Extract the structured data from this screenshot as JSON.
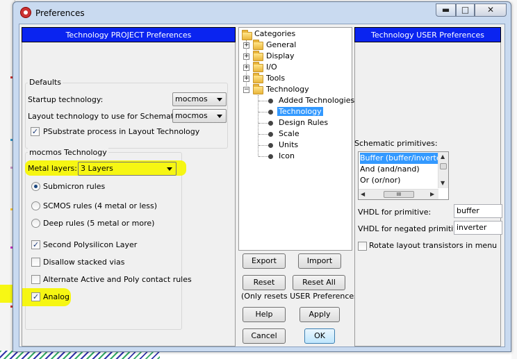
{
  "window": {
    "title": "Preferences",
    "minimize_glyph": "▬",
    "maximize_glyph": "□",
    "close_glyph": "✕",
    "icon": "app-icon"
  },
  "project_panel": {
    "header": "Technology PROJECT Preferences",
    "defaults_title": "Defaults",
    "startup_label": "Startup technology:",
    "startup_value": "mocmos",
    "layout_label": "Layout technology to use for Schematics:",
    "layout_value": "mocmos",
    "psubstrate_label": "PSubstrate process in Layout Technology",
    "psubstrate_checked": "✓",
    "mocmos_title": "mocmos Technology",
    "metal_label": "Metal layers:",
    "metal_value": "3 Layers",
    "rules": [
      {
        "label": "Submicron rules",
        "selected": true
      },
      {
        "label": "SCMOS rules (4 metal or less)",
        "selected": false
      },
      {
        "label": "Deep rules (5 metal or more)",
        "selected": false
      }
    ],
    "second_poly_label": "Second Polysilicon Layer",
    "second_poly_checked": "✓",
    "disallow_label": "Disallow stacked vias",
    "alt_active_label": "Alternate Active and Poly contact rules",
    "analog_label": "Analog",
    "analog_checked": "✓"
  },
  "tree": {
    "root": "Categories",
    "groups": [
      "General",
      "Display",
      "I/O",
      "Tools"
    ],
    "open_group": "Technology",
    "children": [
      "Added Technologies",
      "Technology",
      "Design Rules",
      "Scale",
      "Units",
      "Icon"
    ],
    "selected_child": "Technology",
    "plus": "+",
    "minus": "−"
  },
  "buttons": {
    "export": "Export",
    "import": "Import",
    "reset": "Reset",
    "reset_all": "Reset All",
    "reset_note": "(Only resets USER Preferences)",
    "help": "Help",
    "apply": "Apply",
    "cancel": "Cancel",
    "ok": "OK"
  },
  "user_panel": {
    "header": "Technology USER Preferences",
    "schematic_label": "Schematic primitives:",
    "primitives": [
      "Buffer  (buffer/inverter)",
      "And  (and/nand)",
      "Or  (or/nor)"
    ],
    "vhdl_label": "VHDL for primitive:",
    "vhdl_value": "buffer",
    "vhdl_neg_label": "VHDL for negated primitive:",
    "vhdl_neg_value": "inverter",
    "rotate_label": "Rotate layout transistors in menu",
    "scroll_up": "▲",
    "scroll_down": "▼",
    "scroll_left": "◀",
    "scroll_right": "▶",
    "grip": "III"
  },
  "colors": {
    "header_blue": "#0a24f0",
    "highlight_yellow": "#f6f600",
    "selection_blue": "#3399ff"
  }
}
